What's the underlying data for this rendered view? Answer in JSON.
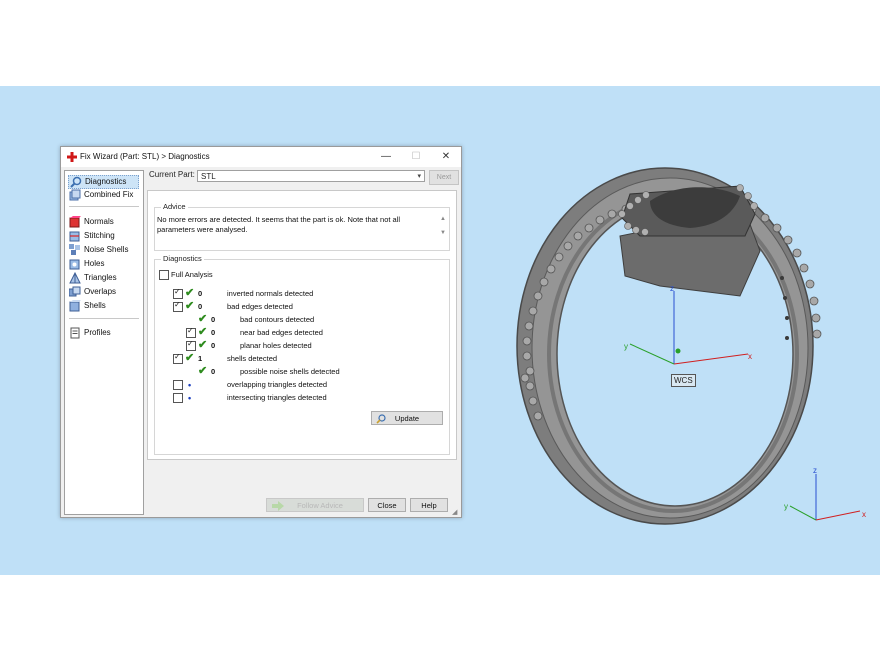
{
  "dialog": {
    "title": "Fix Wizard (Part: STL) > Diagnostics",
    "win_minimize": "—",
    "win_maximize": "☐",
    "win_close": "✕",
    "nav": {
      "items": [
        {
          "label": "Diagnostics",
          "icon": "diagnostics-icon",
          "selected": true
        },
        {
          "label": "Combined Fix",
          "icon": "combined-fix-icon"
        },
        {
          "label": "Normals",
          "icon": "normals-icon"
        },
        {
          "label": "Stitching",
          "icon": "stitching-icon"
        },
        {
          "label": "Noise Shells",
          "icon": "noise-shells-icon"
        },
        {
          "label": "Holes",
          "icon": "holes-icon"
        },
        {
          "label": "Triangles",
          "icon": "triangles-icon"
        },
        {
          "label": "Overlaps",
          "icon": "overlaps-icon"
        },
        {
          "label": "Shells",
          "icon": "shells-icon"
        },
        {
          "label": "Profiles",
          "icon": "profiles-icon"
        }
      ]
    },
    "current_part_label": "Current Part:",
    "current_part_value": "STL",
    "next_label": "Next",
    "advice": {
      "title": "Advice",
      "text": "No more errors are detected. It seems that the part is ok. Note that not all parameters were analysed."
    },
    "diagnostics": {
      "title": "Diagnostics",
      "full_analysis_label": "Full Analysis",
      "full_analysis_checked": false,
      "rows": [
        {
          "checked": true,
          "status": "ok",
          "count": "0",
          "label": "inverted normals detected"
        },
        {
          "checked": true,
          "status": "ok",
          "count": "0",
          "label": "bad edges detected"
        },
        {
          "checked": null,
          "status": "ok",
          "count": "0",
          "label": "bad contours detected"
        },
        {
          "checked": true,
          "status": "ok",
          "count": "0",
          "label": "near bad edges detected"
        },
        {
          "checked": true,
          "status": "ok",
          "count": "0",
          "label": "planar holes detected"
        },
        {
          "checked": true,
          "status": "ok",
          "count": "1",
          "label": "shells detected"
        },
        {
          "checked": null,
          "status": "ok",
          "count": "0",
          "label": "possible noise shells detected"
        },
        {
          "checked": false,
          "status": "dot",
          "count": "",
          "label": "overlapping triangles detected"
        },
        {
          "checked": false,
          "status": "dot",
          "count": "",
          "label": "intersecting triangles detected"
        }
      ],
      "update_label": "Update"
    },
    "buttons": {
      "follow_advice": "Follow Advice",
      "close": "Close",
      "help": "Help"
    }
  },
  "viewport": {
    "background": "#bfe0f7",
    "axis_x": "x",
    "axis_y": "y",
    "axis_z": "z",
    "wcs_label": "WCS",
    "mini_axis_x": "x",
    "mini_axis_y": "y",
    "mini_axis_z": "z"
  }
}
